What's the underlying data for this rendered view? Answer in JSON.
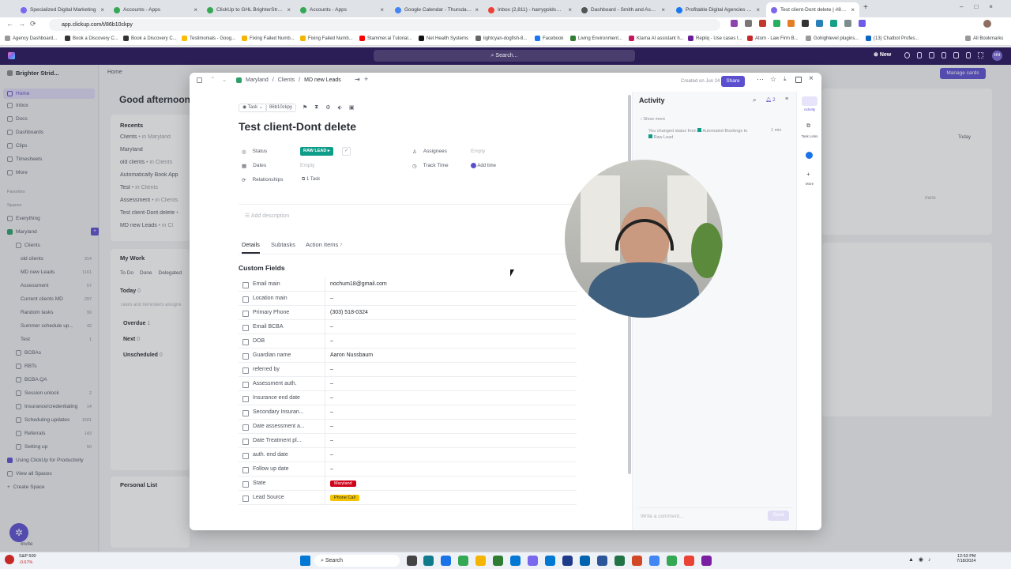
{
  "browser": {
    "tabs": [
      {
        "title": "Specialized Digital Marketing",
        "color": "#7b68ee"
      },
      {
        "title": "Accounts - Apps",
        "color": "#34a853"
      },
      {
        "title": "ClickUp to GHL BrighterStrides",
        "color": "#34a853"
      },
      {
        "title": "Accounts - Apps",
        "color": "#34a853"
      },
      {
        "title": "Google Calendar - Thursday, Ju",
        "color": "#4285f4"
      },
      {
        "title": "Inbox (2,811) - harrygoldsmith",
        "color": "#ea4335"
      },
      {
        "title": "Dashboard - Smith and Associa",
        "color": "#555555"
      },
      {
        "title": "Profitable Digital Agencies | If y",
        "color": "#1877f2"
      },
      {
        "title": "Test client-Dont delete | #86b1",
        "color": "#7b68ee"
      }
    ],
    "url": "app.clickup.com/t/86b10ckpy",
    "bookmarks": [
      "Agency Dashboard...",
      "Book a Discovery C...",
      "Book a Discovery C...",
      "Testimonials - Goog...",
      "Fixing Failed Numb...",
      "Fixing Failed Numb...",
      "Stammer.ai Tutorial...",
      "Net Health Systems",
      "lightcyan-dogfish-8...",
      "Facebook",
      "Living Environment...",
      "Klarna AI assistant h...",
      "Repliq - Use cases t...",
      "Atom - Law Firm B...",
      "Gohighlevel plugins...",
      "(13) Chatbot Profes..."
    ],
    "all_bookmarks": "All Bookmarks"
  },
  "clickup": {
    "search_placeholder": "Search...",
    "new_label": "New",
    "user_initials": "HH"
  },
  "sidebar": {
    "workspace": "Brighter Strid...",
    "nav": [
      {
        "label": "Home"
      },
      {
        "label": "Inbox"
      },
      {
        "label": "Docs"
      },
      {
        "label": "Dashboards"
      },
      {
        "label": "Clips"
      },
      {
        "label": "Timesheets"
      },
      {
        "label": "More"
      }
    ],
    "favorites": "Favorites",
    "spaces": "Spaces",
    "everything": "Everything",
    "space": "Maryland",
    "lists": [
      {
        "label": "Clients",
        "count": ""
      },
      {
        "label": "old clients",
        "count": "314"
      },
      {
        "label": "MD new Leads",
        "count": "1161"
      },
      {
        "label": "Assessment",
        "count": "57"
      },
      {
        "label": "Current clients MD",
        "count": "297"
      },
      {
        "label": "Random tasks",
        "count": "99"
      },
      {
        "label": "Summer schedule up...",
        "count": "42"
      },
      {
        "label": "Test",
        "count": "1"
      },
      {
        "label": "BCBAs",
        "count": ""
      },
      {
        "label": "RBTs",
        "count": ""
      },
      {
        "label": "BCBA QA",
        "count": ""
      },
      {
        "label": "Session unlock",
        "count": "2"
      },
      {
        "label": "Insurance/credentialing",
        "count": "14"
      },
      {
        "label": "Scheduling updates",
        "count": "1601"
      },
      {
        "label": "Referrals",
        "count": "143"
      },
      {
        "label": "Setting up",
        "count": "50"
      },
      {
        "label": "Using ClickUp for Productivity",
        "count": ""
      },
      {
        "label": "View all Spaces",
        "count": ""
      },
      {
        "label": "Create Space",
        "count": ""
      }
    ],
    "invite": "Invite"
  },
  "background": {
    "breadcrumb": "Home",
    "greeting": "Good afternoon,",
    "manage_cards": "Manage cards",
    "recents_title": "Recents",
    "recents": [
      {
        "label": "Clients",
        "where": "• in Maryland"
      },
      {
        "label": "Maryland",
        "where": ""
      },
      {
        "label": "old clients",
        "where": "• in Clients"
      },
      {
        "label": "Automatically Book App",
        "where": ""
      },
      {
        "label": "Test",
        "where": "• in Clients"
      },
      {
        "label": "Assessment",
        "where": "• in Clients"
      },
      {
        "label": "Test client-Dont delete",
        "where": "•"
      },
      {
        "label": "MD new Leads",
        "where": "• in Cl"
      }
    ],
    "mywork_title": "My Work",
    "mywork_tabs": [
      "To Do",
      "Done",
      "Delegated"
    ],
    "mywork_hint": "Tasks and reminders assigne",
    "groups": [
      {
        "label": "Today",
        "count": "0"
      },
      {
        "label": "Overdue",
        "count": "1"
      },
      {
        "label": "Next",
        "count": "0"
      },
      {
        "label": "Unscheduled",
        "count": "0"
      }
    ],
    "personal_list": "Personal List",
    "today_label": "Today",
    "more_link": "more"
  },
  "task": {
    "type": "Task",
    "id": "86b10ckpy",
    "breadcrumb": [
      "Maryland",
      "Clients",
      "MD new Leads"
    ],
    "created": "Created on Jun 24",
    "share": "Share",
    "title": "Test client-Dont delete",
    "status_label": "Status",
    "status_value": "RAW LEAD",
    "status_color": "#0f9d8a",
    "dates_label": "Dates",
    "dates_value": "Empty",
    "relationships_label": "Relationships",
    "relationships_value": "1 Task",
    "assignees_label": "Assignees",
    "assignees_value": "Empty",
    "track_time_label": "Track Time",
    "track_time_value": "Add time",
    "add_description": "Add description",
    "tabs": [
      {
        "label": "Details",
        "count": ""
      },
      {
        "label": "Subtasks",
        "count": ""
      },
      {
        "label": "Action Items",
        "count": "7"
      }
    ],
    "custom_fields_title": "Custom Fields",
    "fields": [
      {
        "label": "Email main",
        "value": "nochum18@gmail.com"
      },
      {
        "label": "Location main",
        "value": "–"
      },
      {
        "label": "Primary Phone",
        "value": "(303) 518-0324"
      },
      {
        "label": "Email BCBA",
        "value": "–"
      },
      {
        "label": "DOB",
        "value": "–"
      },
      {
        "label": "Guardian name",
        "value": "Aaron Nussbaum"
      },
      {
        "label": "referred by",
        "value": "–"
      },
      {
        "label": "Assessment auth.",
        "value": "–"
      },
      {
        "label": "Insurance end date",
        "value": "–"
      },
      {
        "label": "Secondary Insuran...",
        "value": "–"
      },
      {
        "label": "Date assessment a...",
        "value": "–"
      },
      {
        "label": "Date Treatment pl...",
        "value": "–"
      },
      {
        "label": "auth. end date",
        "value": "–"
      },
      {
        "label": "Follow up date",
        "value": "–"
      }
    ],
    "state_label": "State",
    "state_value": "Maryland",
    "state_color": "#d0021b",
    "lead_source_label": "Lead Source",
    "lead_source_value": "Phone Call",
    "lead_source_color": "#f5c400"
  },
  "activity": {
    "title": "Activity",
    "notif_count": "2",
    "show_more": "Show more",
    "entry_prefix": "You changed status from",
    "entry_from": "Automated Bookings to",
    "entry_to": "Raw Lead",
    "entry_time": "1 min",
    "comment_placeholder": "Write a comment...",
    "send": "Send",
    "rail": [
      {
        "label": "Activity"
      },
      {
        "label": "Task Links"
      },
      {
        "label": "More"
      }
    ]
  },
  "taskbar": {
    "stock_name": "S&P 500",
    "stock_change": "-0.67%",
    "search": "Search",
    "time": "12:53 PM",
    "date": "7/18/2024"
  }
}
